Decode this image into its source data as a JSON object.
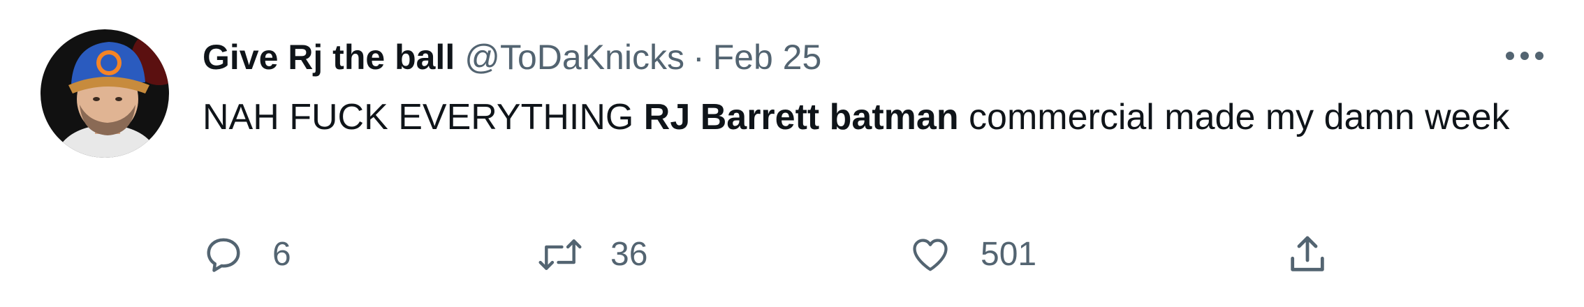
{
  "tweet": {
    "author": {
      "display_name": "Give Rj the ball",
      "handle": "@ToDaKnicks"
    },
    "separator": "·",
    "timestamp": "Feb 25",
    "text_parts": {
      "before": "NAH FUCK EVERYTHING ",
      "bold": "RJ Barrett batman",
      "after": " commercial made my damn week"
    },
    "actions": {
      "reply_count": "6",
      "retweet_count": "36",
      "like_count": "501"
    },
    "icons": {
      "reply": "reply-icon",
      "retweet": "retweet-icon",
      "like": "heart-icon",
      "share": "share-icon",
      "more": "more-icon"
    },
    "colors": {
      "text": "#0f1419",
      "secondary": "#536471"
    }
  }
}
